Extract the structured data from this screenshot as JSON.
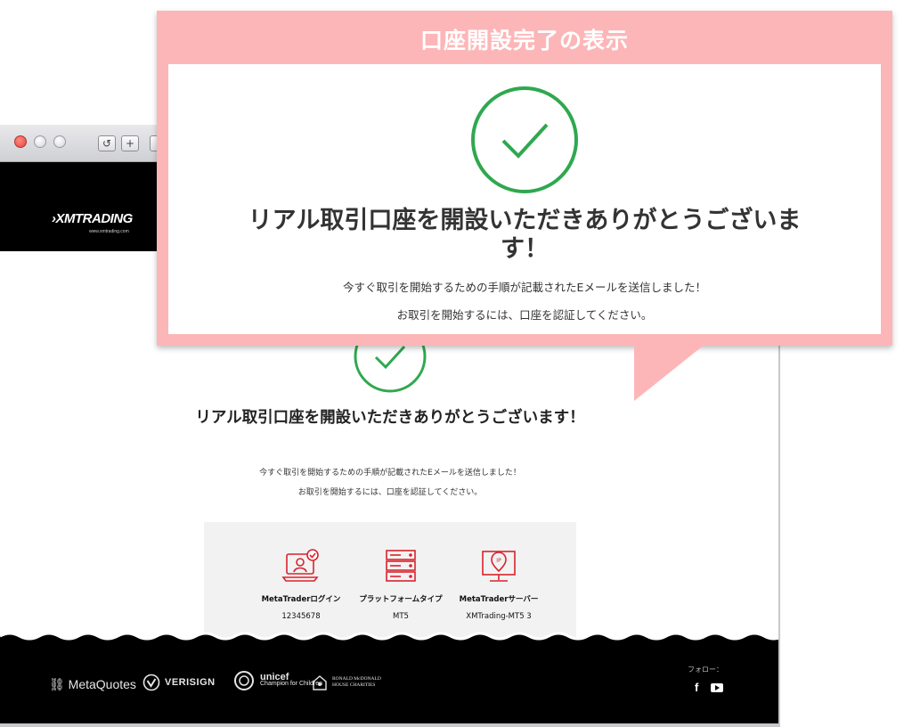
{
  "callout": {
    "title": "口座開設完了の表示",
    "heading": "リアル取引口座を開設いただきありがとうございます！",
    "message_1": "今すぐ取引を開始するための手順が記載されたEメールを送信しました！",
    "message_2": "お取引を開始するには、口座を認証してください。"
  },
  "browser": {
    "reload_icon": "↺",
    "new_tab_icon": "+"
  },
  "header": {
    "logo": "XMTRADING",
    "logo_sub": "www.xmtrading.com"
  },
  "page": {
    "title": "リアル取引口座を開設いただきありがとうございます！",
    "message_1": "今すぐ取引を開始するための手順が記載されたEメールを送信しました！",
    "message_2": "お取引を開始するには、口座を認証してください。"
  },
  "info": [
    {
      "label": "MetaTraderログイン",
      "value": "12345678",
      "icon": "user-check-icon"
    },
    {
      "label": "プラットフォームタイプ",
      "value": "MT5",
      "icon": "server-icon"
    },
    {
      "label": "MetaTraderサーバー",
      "value": "XMTrading-MT5 3",
      "icon": "ip-monitor-icon"
    }
  ],
  "footer": {
    "metaquotes": "MetaQuotes",
    "verisign": "VERISIGN",
    "unicef_title": "unicef",
    "unicef_sub": "Champion for Children",
    "rmhc": "RONALD McDONALD HOUSE CHARITIES",
    "follow": "フォロー：",
    "facebook": "f"
  },
  "colors": {
    "accent_pink": "#fdb6b8",
    "check_green": "#2fa84f",
    "icon_red": "#d9232e"
  }
}
